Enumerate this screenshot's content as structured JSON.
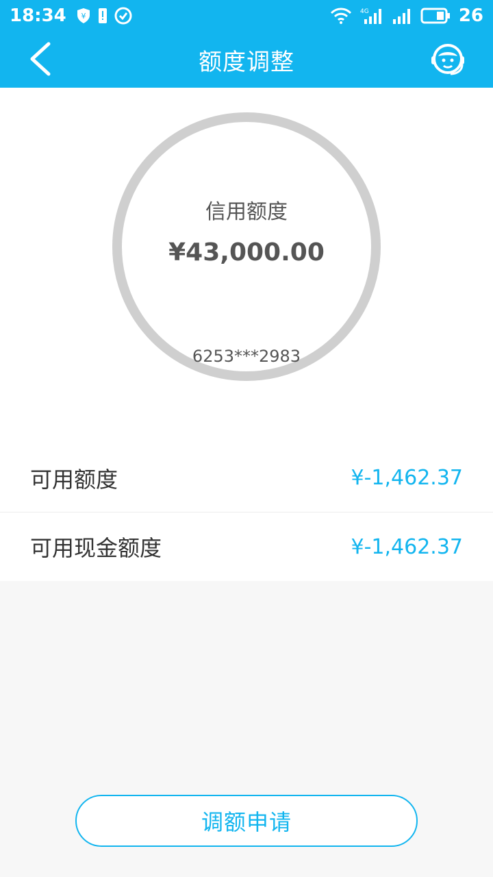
{
  "status": {
    "time": "18:34",
    "battery": "26",
    "network": "4G"
  },
  "nav": {
    "title": "额度调整"
  },
  "credit": {
    "label": "信用额度",
    "amount": "¥43,000.00",
    "card_no": "6253***2983"
  },
  "rows": [
    {
      "label": "可用额度",
      "value": "¥-1,462.37"
    },
    {
      "label": "可用现金额度",
      "value": "¥-1,462.37"
    }
  ],
  "actions": {
    "apply": "调额申请"
  },
  "colors": {
    "brand": "#12b5ef",
    "ring": "#cfcfcf"
  }
}
